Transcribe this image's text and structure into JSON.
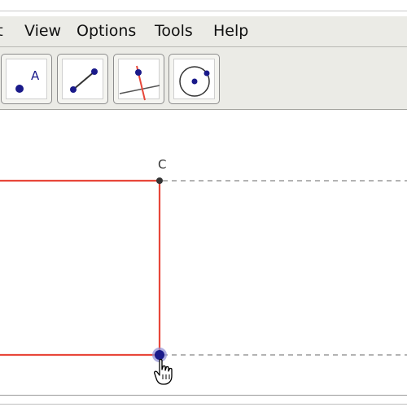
{
  "menu": {
    "items": [
      "it",
      "View",
      "Options",
      "Tools",
      "Help"
    ]
  },
  "toolbar": {
    "tools": [
      {
        "name": "point-tool",
        "icon": "point-icon",
        "glyph": "A"
      },
      {
        "name": "segment-tool",
        "icon": "segment-icon"
      },
      {
        "name": "perpendicular-line-tool",
        "icon": "perpendicular-line-icon"
      },
      {
        "name": "circle-tool",
        "icon": "circle-icon"
      }
    ]
  },
  "canvas": {
    "point_label": "C",
    "colors": {
      "rectangle": "#e8473a",
      "guide": "#9a9a9a",
      "point": "#1a1a8a",
      "point_halo": "#8f8fd6",
      "vertex": "#333333"
    },
    "cursor_icon": "hand-pointer-icon"
  }
}
